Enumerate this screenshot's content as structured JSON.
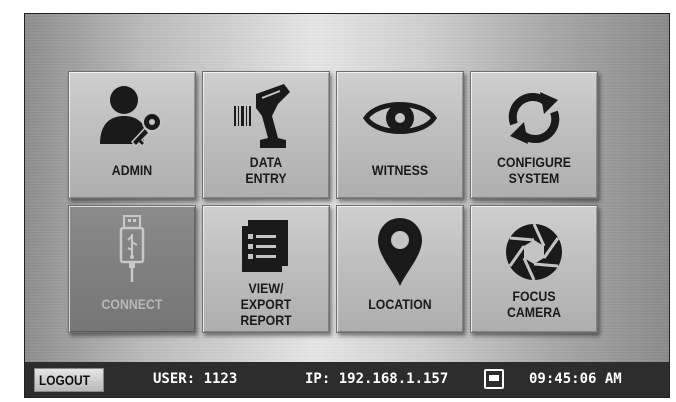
{
  "tiles": [
    {
      "id": "admin",
      "label": "ADMIN",
      "icon": "admin-user-key-icon",
      "enabled": true
    },
    {
      "id": "data-entry",
      "label": "DATA\nENTRY",
      "icon": "barcode-scanner-icon",
      "enabled": true
    },
    {
      "id": "witness",
      "label": "WITNESS",
      "icon": "eye-icon",
      "enabled": true
    },
    {
      "id": "configure-system",
      "label": "CONFIGURE\nSYSTEM",
      "icon": "sync-arrows-icon",
      "enabled": true
    },
    {
      "id": "connect",
      "label": "CONNECT",
      "icon": "usb-drive-icon",
      "enabled": false
    },
    {
      "id": "view-export-report",
      "label": "VIEW/\nEXPORT\nREPORT",
      "icon": "report-list-icon",
      "enabled": true
    },
    {
      "id": "location",
      "label": "LOCATION",
      "icon": "map-pin-icon",
      "enabled": true
    },
    {
      "id": "focus-camera",
      "label": "FOCUS\nCAMERA",
      "icon": "camera-aperture-icon",
      "enabled": true
    }
  ],
  "status": {
    "logout_label": "LOGOUT",
    "user": "USER: 1123",
    "ip": "IP: 192.168.1.157",
    "network_icon": "ethernet-port-icon",
    "time": "09:45:06 AM"
  },
  "colors": {
    "status_bar_bg": "#2d2d2d",
    "tile_bg": "#c0c0c0",
    "tile_disabled_bg": "#808080",
    "icon_dark": "#1a1a1a"
  }
}
